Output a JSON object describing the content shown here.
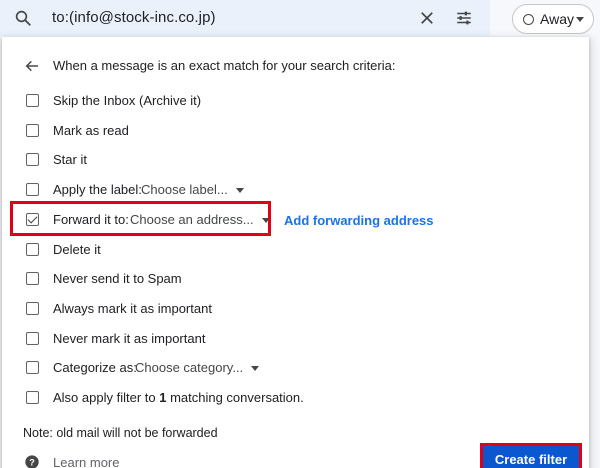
{
  "search": {
    "query": "to:(info@stock-inc.co.jp)"
  },
  "status": {
    "label": "Away"
  },
  "filter": {
    "criteria_text": "When a message is an exact match for your search criteria:",
    "options": {
      "skip_inbox": {
        "label": "Skip the Inbox (Archive it)",
        "checked": false
      },
      "mark_read": {
        "label": "Mark as read",
        "checked": false
      },
      "star": {
        "label": "Star it",
        "checked": false
      },
      "apply_label": {
        "label": "Apply the label:",
        "dropdown": "Choose label...",
        "checked": false
      },
      "forward": {
        "label": "Forward it to:",
        "dropdown": "Choose an address...",
        "checked": true
      },
      "delete": {
        "label": "Delete it",
        "checked": false
      },
      "never_spam": {
        "label": "Never send it to Spam",
        "checked": false
      },
      "always_important": {
        "label": "Always mark it as important",
        "checked": false
      },
      "never_important": {
        "label": "Never mark it as important",
        "checked": false
      },
      "categorize": {
        "label": "Categorize as:",
        "dropdown": "Choose category...",
        "checked": false
      },
      "apply_existing": {
        "prefix": "Also apply filter to ",
        "count": "1",
        "suffix": " matching conversation.",
        "checked": false
      }
    },
    "add_forwarding_link": "Add forwarding address",
    "note": "Note: old mail will not be forwarded",
    "learn_more": "Learn more",
    "create_button": "Create filter"
  },
  "colors": {
    "accent_blue": "#1a73e8",
    "primary_button": "#0b57d0",
    "highlight_red": "#e0001a"
  }
}
